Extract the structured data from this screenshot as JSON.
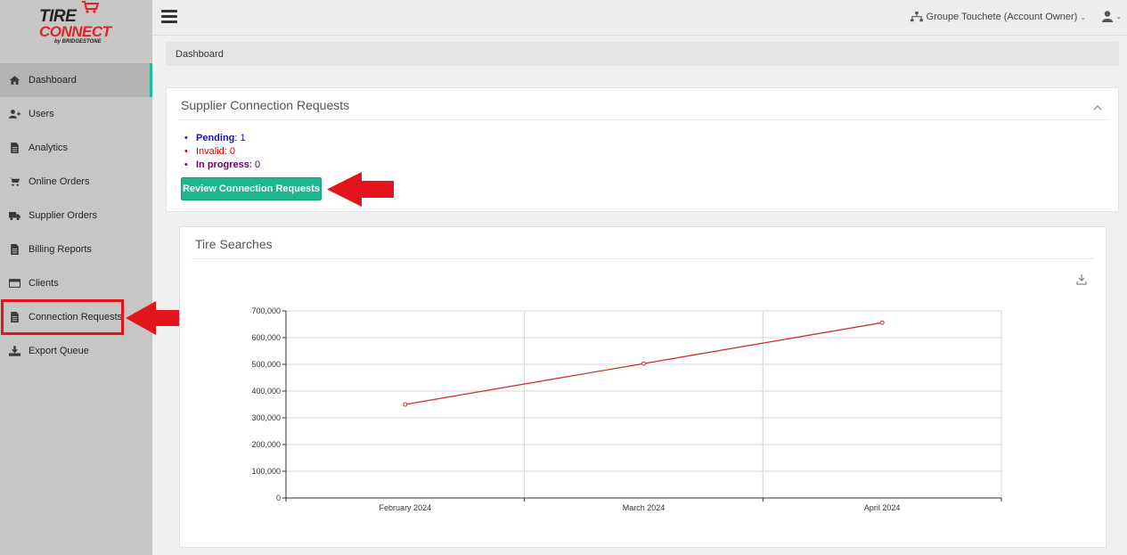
{
  "brand": {
    "logo_line1": "TIRE",
    "logo_line2": "CONNECT",
    "logo_byline": "by BRIDGESTONE",
    "accent": "#1abc9c",
    "brand_red": "#d9252b"
  },
  "sidebar": {
    "items": [
      {
        "label": "Dashboard",
        "icon": "home-icon",
        "active": true
      },
      {
        "label": "Users",
        "icon": "user-plus-icon"
      },
      {
        "label": "Analytics",
        "icon": "file-icon"
      },
      {
        "label": "Online Orders",
        "icon": "cart-icon"
      },
      {
        "label": "Supplier Orders",
        "icon": "truck-icon"
      },
      {
        "label": "Billing Reports",
        "icon": "file-icon"
      },
      {
        "label": "Clients",
        "icon": "credit-card-icon"
      },
      {
        "label": "Connection Requests",
        "icon": "file-icon"
      },
      {
        "label": "Export Queue",
        "icon": "download-icon"
      }
    ]
  },
  "topbar": {
    "account_label": "Groupe Touchete (Account Owner)",
    "account_icon": "sitemap-icon",
    "user_icon": "user-icon"
  },
  "breadcrumb": {
    "current": "Dashboard"
  },
  "supplier_panel": {
    "title": "Supplier Connection Requests",
    "statuses": [
      {
        "label": "Pending",
        "count": "1",
        "color": "#1010c8"
      },
      {
        "label": "Invalid",
        "count": "0",
        "color": "#e00000"
      },
      {
        "label": "In progress",
        "count": "0",
        "color": "#6b006b"
      }
    ],
    "review_button": "Review Connection Requests"
  },
  "tire_panel": {
    "title": "Tire Searches"
  },
  "chart_data": {
    "type": "line",
    "title": "Tire Searches",
    "categories": [
      "February 2024",
      "March 2024",
      "April 2024"
    ],
    "series": [
      {
        "values": [
          350000,
          503000,
          656000
        ],
        "color": "#cc3333"
      }
    ],
    "ylim": [
      0,
      700000
    ],
    "yticks": [
      0,
      100000,
      200000,
      300000,
      400000,
      500000,
      600000,
      700000
    ],
    "ytick_labels": [
      "0",
      "100,000",
      "200,000",
      "300,000",
      "400,000",
      "500,000",
      "600,000",
      "700,000"
    ],
    "grid": true,
    "legend": "none"
  }
}
